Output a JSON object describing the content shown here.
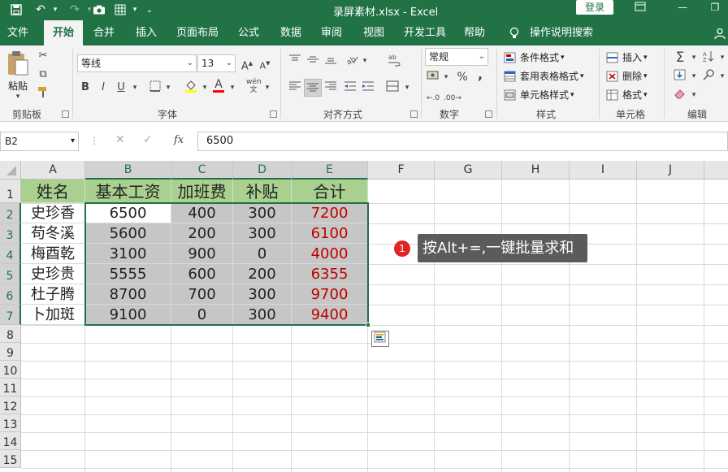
{
  "window": {
    "title": "录屏素材.xlsx  -  Excel",
    "login_label": "登录"
  },
  "quick_access": {
    "save_icon": "save-icon",
    "undo_icon": "undo-icon",
    "redo_icon": "redo-icon",
    "camera_icon": "camera-icon",
    "grid_icon": "grid-icon",
    "customize_icon": "customize-icon"
  },
  "tabs": [
    "文件",
    "开始",
    "合并",
    "插入",
    "页面布局",
    "公式",
    "数据",
    "审阅",
    "视图",
    "开发工具",
    "帮助",
    "操作说明搜索"
  ],
  "active_tab": "开始",
  "ribbon": {
    "clipboard": {
      "paste_label": "粘贴",
      "group_label": "剪贴板"
    },
    "font": {
      "font_name": "等线",
      "font_size": "13",
      "group_label": "字体",
      "bold": "B",
      "italic": "I",
      "underline": "U",
      "grow": "A",
      "shrink": "A",
      "font_color_letter": "A",
      "phonetic": "wén"
    },
    "alignment": {
      "group_label": "对齐方式"
    },
    "number": {
      "format": "常规",
      "group_label": "数字",
      "percent": "%",
      "comma": ","
    },
    "styles": {
      "conditional": "条件格式",
      "table": "套用表格格式",
      "cell_style": "单元格样式",
      "group_label": "样式"
    },
    "cells": {
      "insert": "插入",
      "delete": "删除",
      "format": "格式",
      "group_label": "单元格"
    },
    "editing": {
      "group_label": "编辑"
    }
  },
  "formula_bar": {
    "name_box": "B2",
    "fx": "fx",
    "formula": "6500"
  },
  "columns": [
    "A",
    "B",
    "C",
    "D",
    "E",
    "F",
    "G",
    "H",
    "I",
    "J"
  ],
  "rows": [
    "1",
    "2",
    "3",
    "4",
    "5",
    "6",
    "7",
    "8",
    "9",
    "10",
    "11",
    "12",
    "13",
    "14",
    "15"
  ],
  "table": {
    "headers": [
      "姓名",
      "基本工资",
      "加班费",
      "补贴",
      "合计"
    ],
    "rows": [
      [
        "史珍香",
        "6500",
        "400",
        "300",
        "7200"
      ],
      [
        "苟冬溪",
        "5600",
        "200",
        "300",
        "6100"
      ],
      [
        "梅酉乾",
        "3100",
        "900",
        "0",
        "4000"
      ],
      [
        "史珍贵",
        "5555",
        "600",
        "200",
        "6355"
      ],
      [
        "杜子腾",
        "8700",
        "700",
        "300",
        "9700"
      ],
      [
        "卜加斑",
        "9100",
        "0",
        "300",
        "9400"
      ]
    ]
  },
  "tip": {
    "badge": "1",
    "text": "按Alt+=,一键批量求和"
  },
  "colors": {
    "brand": "#217346",
    "header_fill": "#a9d08e",
    "selection_fill": "#c6c6c6",
    "total_text": "#c00000",
    "tip_badge": "#e0242a"
  }
}
